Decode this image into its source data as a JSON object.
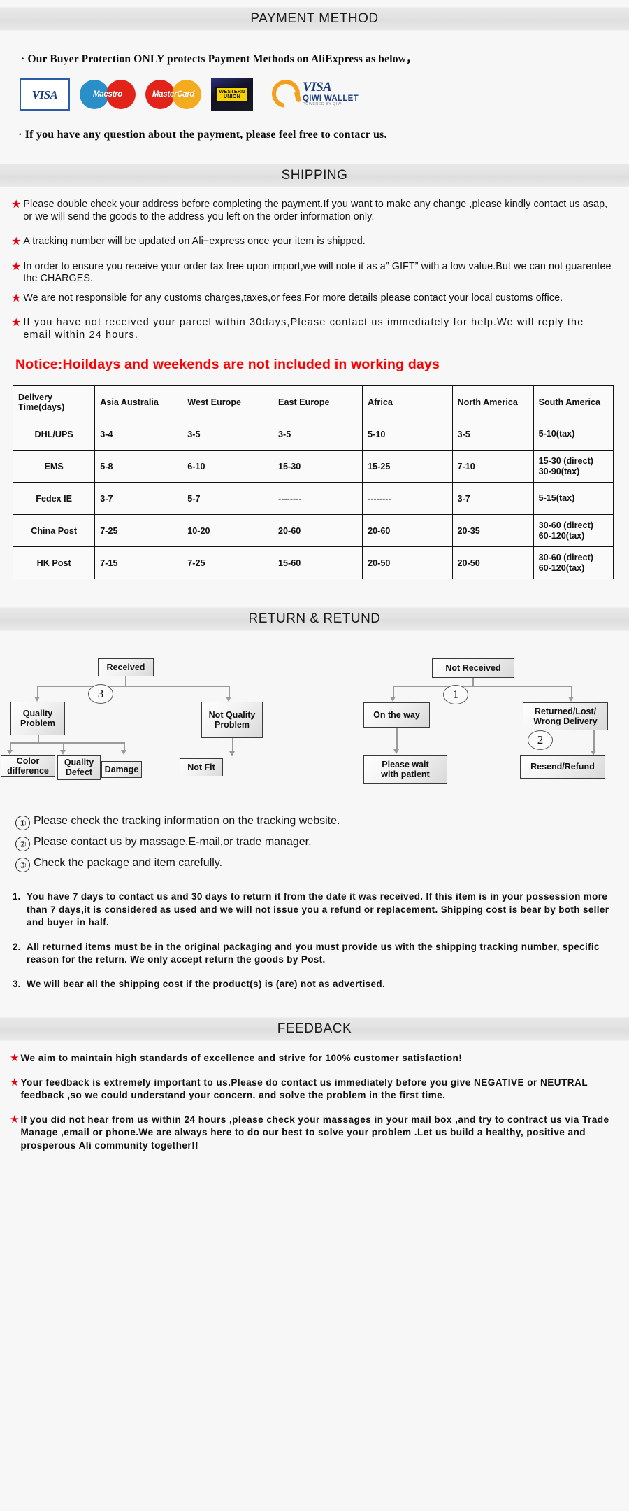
{
  "sections": {
    "payment": {
      "title": "PAYMENT METHOD"
    },
    "shipping": {
      "title": "SHIPPING"
    },
    "return": {
      "title": "RETURN & RETUND"
    },
    "feedback": {
      "title": "FEEDBACK"
    }
  },
  "payment": {
    "line1": "·  Our Buyer Protection ONLY protects Payment Methods on AliExpress as below，",
    "line2": "· If you have any question about the payment, please feel free to contacr us.",
    "logos": [
      {
        "name": "visa-logo",
        "label": "VISA"
      },
      {
        "name": "maestro-logo",
        "label": "Maestro"
      },
      {
        "name": "mastercard-logo",
        "label": "MasterCard"
      },
      {
        "name": "western-union-logo",
        "label1": "WESTERN",
        "label2": "UNION"
      },
      {
        "name": "qiwi-wallet-logo",
        "label1": "VISA",
        "label2": "QIWI WALLET",
        "label3": "POWERED BY QIWI"
      }
    ]
  },
  "shipping": {
    "bullets": [
      "Please double check your address before completing the payment.If you want to make any change ,please kindly contact us asap, or we will send the goods to the address you left on the order information only.",
      "A tracking number will be updated on Ali−express once your item is shipped.",
      "In order to ensure you receive your order tax free upon import,we will note it as a” GIFT” with a low value.But we can not guarentee the CHARGES.",
      "We are not responsible for any customs charges,taxes,or fees.For more details please contact your local customs office.",
      "If you have not received your parcel within 30days,Please contact us immediately for help.We will reply the email within 24 hours."
    ],
    "notice": "Notice:Hoildays and weekends are not included in working days"
  },
  "chart_data": {
    "type": "table",
    "title": "Delivery Time(days)",
    "columns": [
      "Delivery Time(days)",
      "Asia Australia",
      "West Europe",
      "East Europe",
      "Africa",
      "North America",
      "South America"
    ],
    "rows": [
      {
        "method": "DHL/UPS",
        "cells": [
          "3-4",
          "3-5",
          "3-5",
          "5-10",
          "3-5",
          "5-10(tax)"
        ]
      },
      {
        "method": "EMS",
        "cells": [
          "5-8",
          "6-10",
          "15-30",
          "15-25",
          "7-10",
          "15-30\n(direct)\n30-90(tax)"
        ]
      },
      {
        "method": "Fedex IE",
        "cells": [
          "3-7",
          "5-7",
          "--------",
          "--------",
          "3-7",
          "5-15(tax)"
        ]
      },
      {
        "method": "China Post",
        "cells": [
          "7-25",
          "10-20",
          "20-60",
          "20-60",
          "20-35",
          "30-60\n(direct)\n60-120(tax)"
        ]
      },
      {
        "method": "HK Post",
        "cells": [
          "7-15",
          "7-25",
          "15-60",
          "20-50",
          "20-50",
          "30-60\n(direct)\n60-120(tax)"
        ]
      }
    ]
  },
  "flow": {
    "left": {
      "root": "Received",
      "badge": "3",
      "branch_a": "Quality\nProblem",
      "branch_b": "Not Quality\nProblem",
      "leaves_a": [
        "Color\ndifference",
        "Quality\nDefect",
        "Damage"
      ],
      "leaves_b": [
        "Not Fit"
      ]
    },
    "right": {
      "root": "Not  Received",
      "badge1": "1",
      "badge2": "2",
      "branch_a": "On the way",
      "branch_b": "Returned/Lost/\nWrong Delivery",
      "leaf_a": "Please wait\nwith patient",
      "leaf_b": "Resend/Refund"
    }
  },
  "return_notes": {
    "circled": [
      {
        "num": "①",
        "text": "Please check the tracking information on the tracking website."
      },
      {
        "num": "②",
        "text": "Please contact us by  massage,E-mail,or trade manager."
      },
      {
        "num": "③",
        "text": "Check the package and item carefully."
      }
    ],
    "numbered": [
      {
        "n": "1.",
        "text": "You have 7 days to contact us and 30 days to return it from the date it was received. If this item is in your possession more than 7 days,it is considered as used and we will not issue you a refund or replacement. Shipping cost is bear by both seller and buyer in half."
      },
      {
        "n": "2.",
        "text": "All returned items must be in the original packaging and you must provide us with the shipping tracking number, specific reason for the return. We only accept return the goods by Post."
      },
      {
        "n": "3.",
        "text": "We will bear all the shipping cost if the product(s) is (are) not as advertised."
      }
    ]
  },
  "feedback": {
    "bullets": [
      "We aim to maintain high standards of excellence and strive  for 100% customer satisfaction!",
      "Your feedback is extremely important to us.Please do contact us immediately before you give NEGATIVE or NEUTRAL feedback ,so  we could understand your concern. and solve the problem in the first time.",
      "If you did not hear from us within 24 hours ,please check your massages in your mail box ,and try to contract us via Trade Manage ,email or phone.We are always here to do our best to solve your problem .Let us build a healthy, positive and prosperous Ali community together!!"
    ]
  },
  "colors": {
    "star": "#e8000d",
    "notice": "#ff0000",
    "bar": "#e4e4e4"
  }
}
